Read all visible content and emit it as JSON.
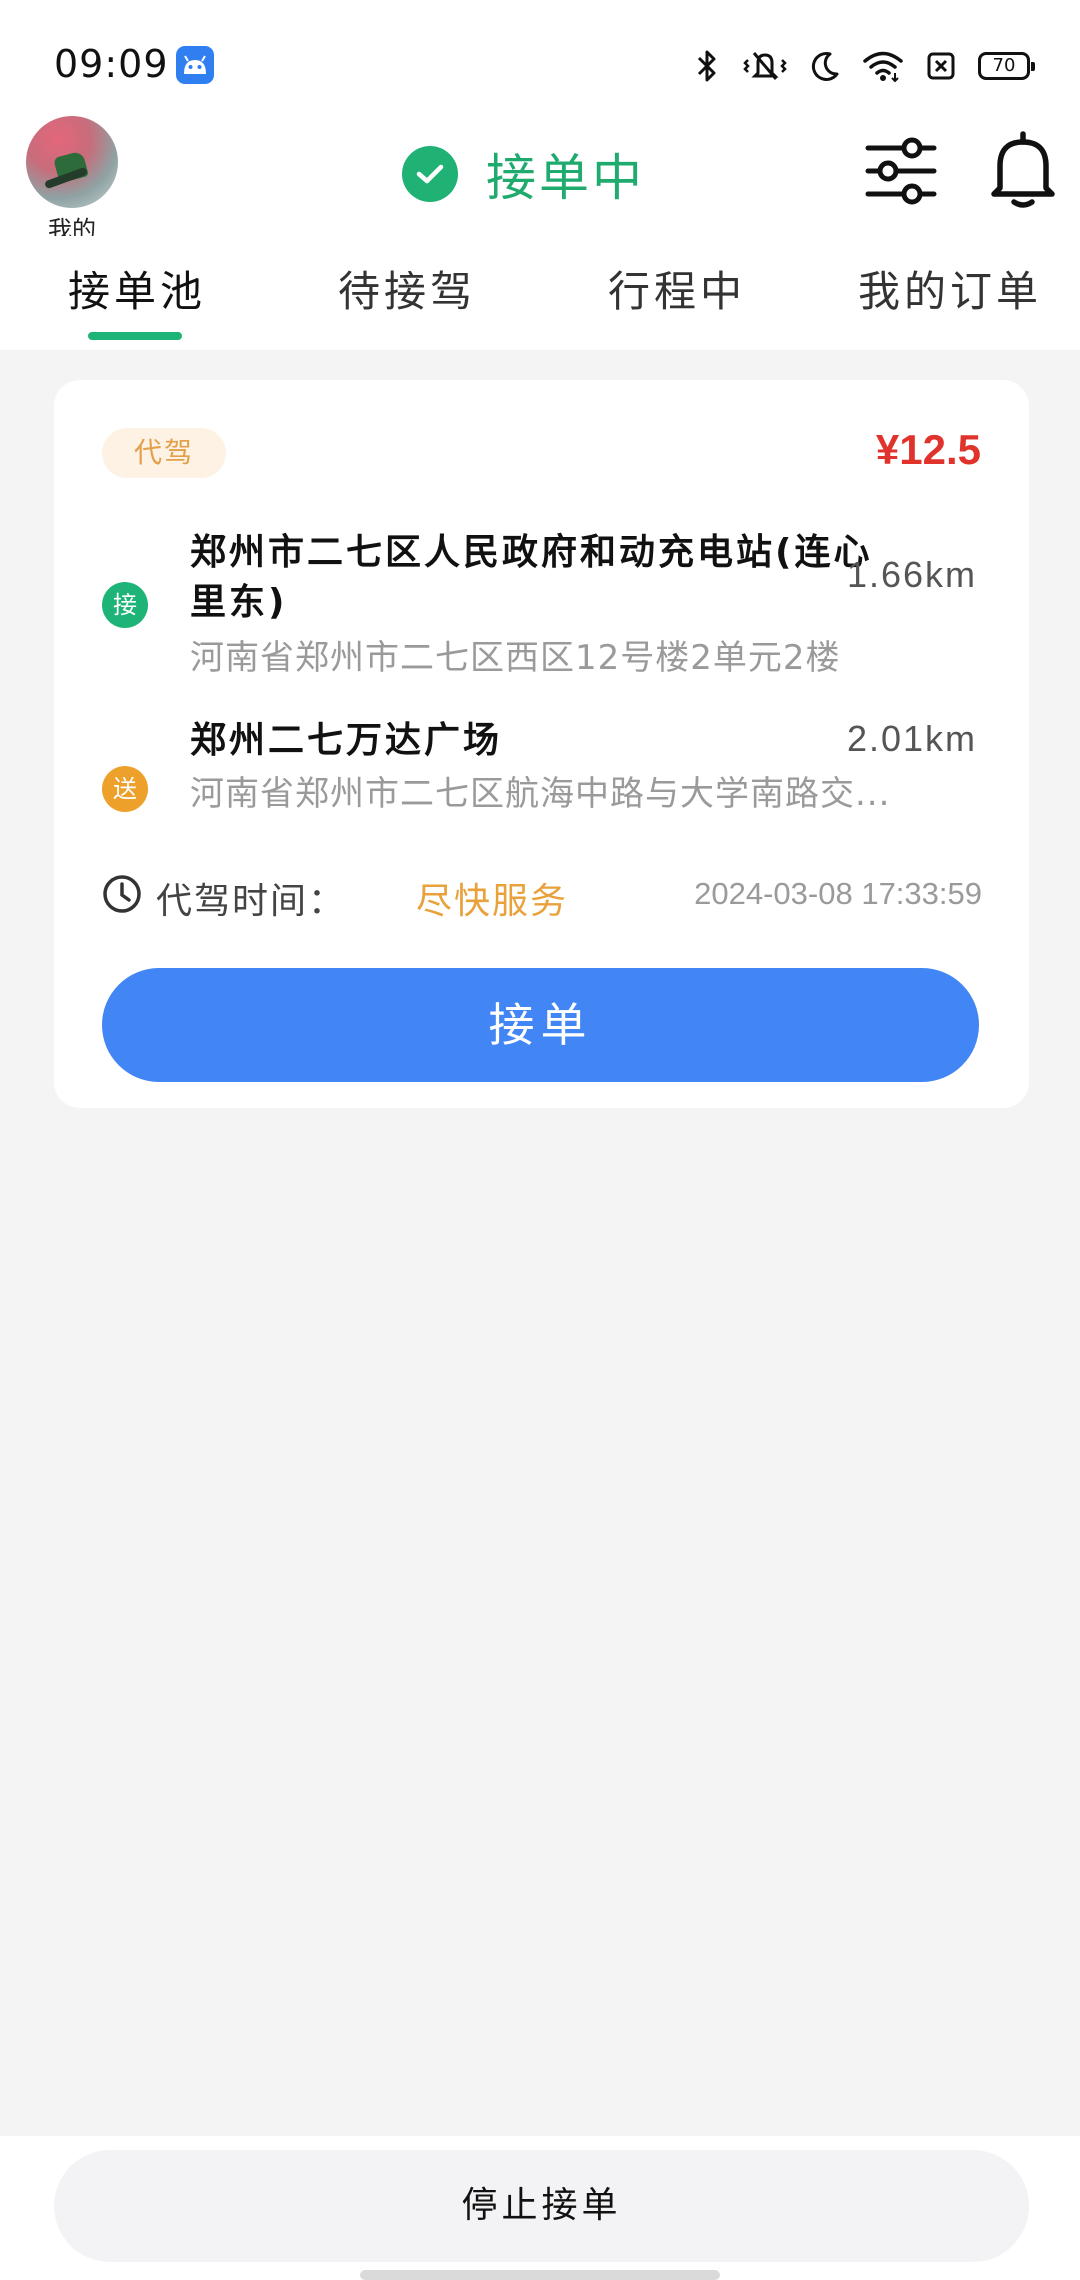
{
  "status_bar": {
    "time": "09:09",
    "battery": "70",
    "icons": [
      "android-app-icon",
      "bluetooth-icon",
      "vibrate-icon",
      "moon-icon",
      "wifi-icon",
      "sim-icon",
      "battery-icon"
    ]
  },
  "header": {
    "avatar_label": "我的",
    "status_label": "接单中",
    "status_color": "#20b274"
  },
  "tabs": [
    {
      "label": "接单池",
      "active": true
    },
    {
      "label": "待接驾",
      "active": false
    },
    {
      "label": "行程中",
      "active": false
    },
    {
      "label": "我的订单",
      "active": false
    }
  ],
  "order": {
    "tag": "代驾",
    "price": "¥12.5",
    "pickup": {
      "badge": "接",
      "title": "郑州市二七区人民政府和动充电站(连心里东)",
      "address": "河南省郑州市二七区西区12号楼2单元2楼",
      "distance": "1.66km"
    },
    "dropoff": {
      "badge": "送",
      "title": "郑州二七万达广场",
      "address": "河南省郑州市二七区航海中路与大学南路交...",
      "distance": "2.01km"
    },
    "time_label": "代驾时间：",
    "time_value": "尽快服务",
    "timestamp": "2024-03-08 17:33:59",
    "accept_label": "接单"
  },
  "bottom": {
    "stop_label": "停止接单"
  },
  "colors": {
    "accent_green": "#1fb477",
    "price_red": "#e0332c",
    "button_blue": "#4285f4",
    "tag_orange": "#e3a04a"
  }
}
